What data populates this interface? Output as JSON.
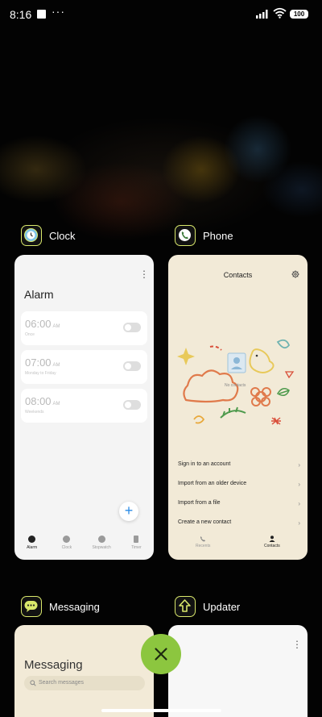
{
  "status_bar": {
    "time": "8:16",
    "dots": "···",
    "battery": "100"
  },
  "recents": {
    "apps": [
      {
        "name": "Clock",
        "icon": "clock-icon",
        "screen": {
          "title": "Alarm",
          "alarms": [
            {
              "time": "06:00",
              "ampm": "AM",
              "detail": "Once",
              "enabled": false
            },
            {
              "time": "07:00",
              "ampm": "AM",
              "detail": "Monday to Friday",
              "enabled": false
            },
            {
              "time": "08:00",
              "ampm": "AM",
              "detail": "Weekends",
              "enabled": false
            }
          ],
          "fab": "+",
          "tabs": [
            "Alarm",
            "Clock",
            "Stopwatch",
            "Timer"
          ],
          "active_tab": "Alarm"
        }
      },
      {
        "name": "Phone",
        "icon": "phone-icon",
        "screen": {
          "title": "Contacts",
          "empty_text": "No contacts",
          "options": [
            "Sign in to an account",
            "Import from an older device",
            "Import from a file",
            "Create a new contact"
          ],
          "tabs": [
            "Recents",
            "Contacts"
          ],
          "active_tab": "Contacts"
        }
      },
      {
        "name": "Messaging",
        "icon": "messaging-icon",
        "screen": {
          "title": "Messaging",
          "search_placeholder": "Search messages"
        }
      },
      {
        "name": "Updater",
        "icon": "updater-icon"
      }
    ]
  },
  "colors": {
    "accent_green": "#8cc63f",
    "icon_border": "#d9e86b",
    "fab_blue": "#2b8be6",
    "contacts_bg": "#f2ead7"
  }
}
